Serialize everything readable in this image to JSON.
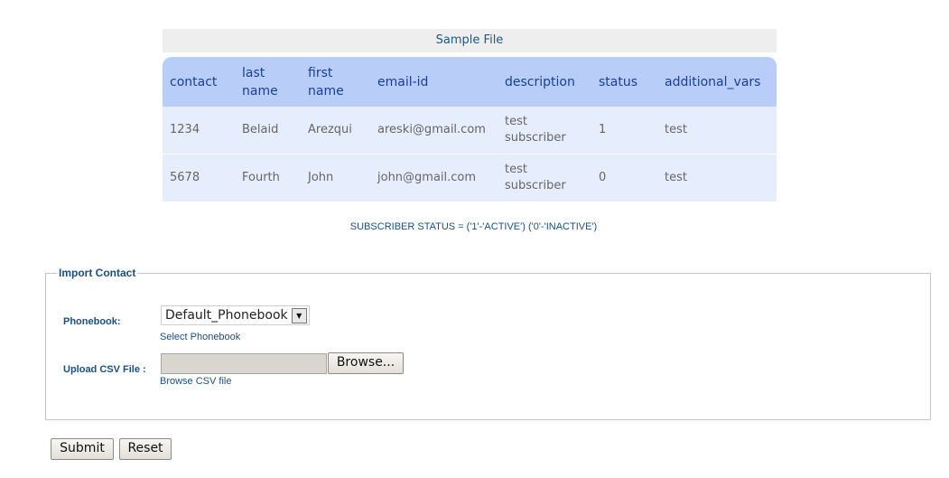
{
  "sample": {
    "header": "Sample File",
    "columns": {
      "contact": "contact",
      "last_name_1": "last",
      "last_name_2": "name",
      "first_name_1": "first",
      "first_name_2": "name",
      "email": "email-id",
      "description": "description",
      "status": "status",
      "additional_vars": "additional_vars"
    },
    "rows": [
      {
        "contact": "1234",
        "last_name": "Belaid",
        "first_name": "Arezqui",
        "email": "areski@gmail.com",
        "description_1": "test",
        "description_2": "subscriber",
        "status": "1",
        "additional_vars": "test"
      },
      {
        "contact": "5678",
        "last_name": "Fourth",
        "first_name": "John",
        "email": "john@gmail.com",
        "description_1": "test",
        "description_2": "subscriber",
        "status": "0",
        "additional_vars": "test"
      }
    ],
    "status_note": "SUBSCRIBER STATUS = ('1'-'ACTIVE') ('0'-'INACTIVE')"
  },
  "import": {
    "legend": "Import Contact",
    "phonebook_label": "Phonebook:",
    "phonebook_selected": "Default_Phonebook",
    "phonebook_hint": "Select Phonebook",
    "csv_label": "Upload CSV File :",
    "browse_button": "Browse...",
    "csv_hint": "Browse CSV file"
  },
  "actions": {
    "submit": "Submit",
    "reset": "Reset"
  },
  "icons": {
    "select_arrow": "chevron-down-icon"
  }
}
